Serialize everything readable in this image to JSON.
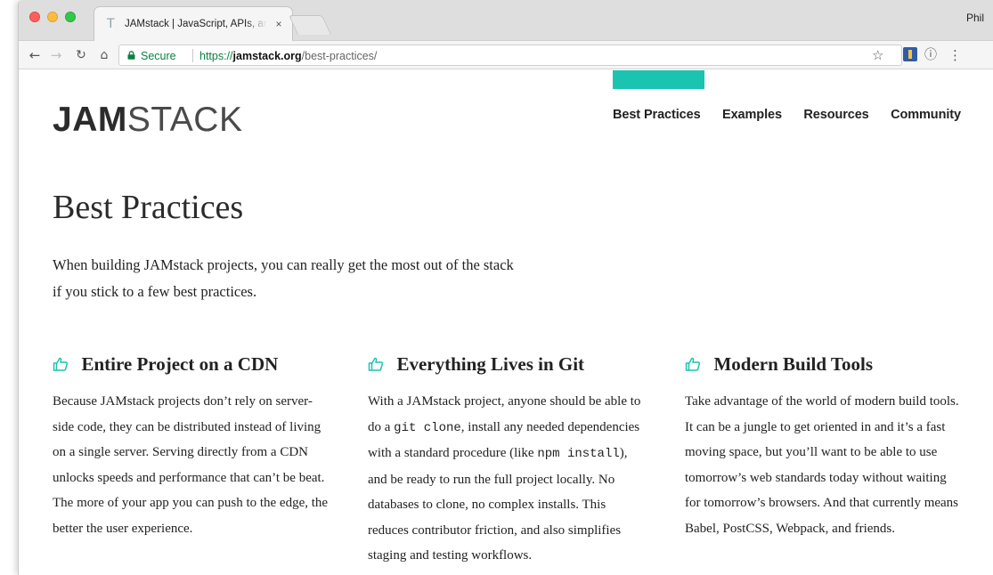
{
  "browser": {
    "tab_title": "JAMstack | JavaScript, APIs, and Markup",
    "tab_close": "×",
    "profile_name": "Phil",
    "secure_label": "Secure",
    "url_proto": "https://",
    "url_host": "jamstack.org",
    "url_path": "/best-practices/",
    "icons": [
      "back-icon",
      "forward-icon",
      "reload-icon",
      "home-icon",
      "lock-icon",
      "star-icon",
      "extension-icon",
      "info-icon",
      "menu-icon"
    ]
  },
  "site": {
    "logo_bold": "JAM",
    "logo_light": "STACK",
    "accent_color": "#1ac4b0",
    "nav": [
      "Best Practices",
      "Examples",
      "Resources",
      "Community"
    ]
  },
  "main": {
    "title": "Best Practices",
    "intro": "When building JAMstack projects, you can really get the most out of the stack if you stick to a few best practices.",
    "columns": [
      {
        "title": "Entire Project on a CDN",
        "body": "Because JAMstack projects don’t rely on server-side code, they can be distributed instead of living on a single server. Serving directly from a CDN unlocks speeds and performance that can’t be beat. The more of your app you can push to the edge, the better the user experience."
      },
      {
        "title": "Everything Lives in Git",
        "body_1": "With a JAMstack project, anyone should be able to do a ",
        "code_1": "git clone",
        "body_2": ", install any needed dependencies with a standard procedure (like ",
        "code_2": "npm install",
        "body_3": "), and be ready to run the full project locally. No databases to clone, no complex installs. This reduces contributor friction, and also simplifies staging and testing workflows."
      },
      {
        "title": "Modern Build Tools",
        "body": "Take advantage of the world of modern build tools. It can be a jungle to get oriented in and it’s a fast moving space, but you’ll want to be able to use tomorrow’s web standards today without waiting for tomorrow’s browsers. And that currently means Babel, PostCSS, Webpack, and friends."
      }
    ]
  }
}
